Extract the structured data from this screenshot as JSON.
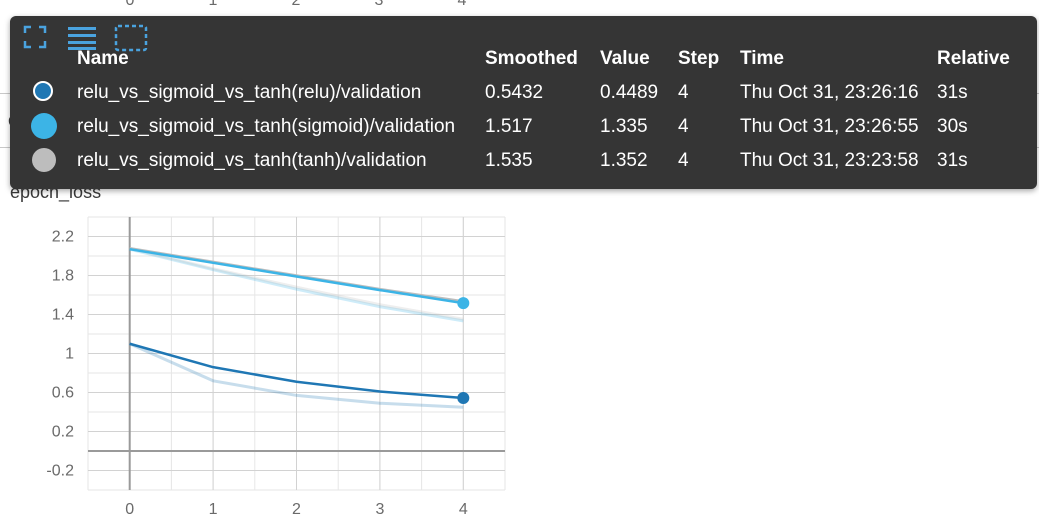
{
  "top_axis_ticks": [
    "0",
    "1",
    "2",
    "3",
    "4"
  ],
  "background_title": "epoch_loss",
  "chart_data": {
    "type": "line",
    "title": "epoch_loss",
    "xlabel": "",
    "ylabel": "",
    "xlim": [
      -0.5,
      4.5
    ],
    "ylim": [
      -0.4,
      2.4
    ],
    "x_ticks": [
      0,
      1,
      2,
      3,
      4
    ],
    "x_tick_labels": [
      "0",
      "1",
      "2",
      "3",
      "4"
    ],
    "y_ticks": [
      -0.2,
      0.2,
      0.6,
      1.0,
      1.4,
      1.8,
      2.2
    ],
    "y_tick_labels": [
      "-0.2",
      "0.2",
      "0.6",
      "1",
      "1.4",
      "1.8",
      "2.2"
    ],
    "grid": true,
    "series": [
      {
        "name": "relu_vs_sigmoid_vs_tanh(relu)/validation",
        "color": "#1f77b4",
        "x": [
          0,
          1,
          2,
          3,
          4
        ],
        "smoothed": [
          1.1,
          0.86,
          0.71,
          0.61,
          0.5432
        ],
        "raw": [
          1.1,
          0.72,
          0.57,
          0.49,
          0.4489
        ]
      },
      {
        "name": "relu_vs_sigmoid_vs_tanh(sigmoid)/validation",
        "color": "#3cb4e6",
        "x": [
          0,
          1,
          2,
          3,
          4
        ],
        "smoothed": [
          2.07,
          1.93,
          1.79,
          1.65,
          1.517
        ],
        "raw": [
          2.07,
          1.86,
          1.66,
          1.48,
          1.335
        ]
      },
      {
        "name": "relu_vs_sigmoid_vs_tanh(tanh)/validation",
        "color": "#bdbdbd",
        "x": [
          0,
          1,
          2,
          3,
          4
        ],
        "smoothed": [
          2.08,
          1.94,
          1.8,
          1.66,
          1.535
        ],
        "raw": [
          2.08,
          1.87,
          1.68,
          1.5,
          1.352
        ]
      }
    ]
  },
  "tooltip": {
    "headers": {
      "name": "Name",
      "smoothed": "Smoothed",
      "value": "Value",
      "step": "Step",
      "time": "Time",
      "relative": "Relative"
    },
    "rows": [
      {
        "swatch_color": "#1f77b4",
        "name": "relu_vs_sigmoid_vs_tanh(relu)/validation",
        "smoothed": "0.5432",
        "value": "0.4489",
        "step": "4",
        "time": "Thu Oct 31, 23:26:16",
        "relative": "31s"
      },
      {
        "swatch_color": "#3cb4e6",
        "name": "relu_vs_sigmoid_vs_tanh(sigmoid)/validation",
        "smoothed": "1.517",
        "value": "1.335",
        "step": "4",
        "time": "Thu Oct 31, 23:26:55",
        "relative": "30s"
      },
      {
        "swatch_color": "#bdbdbd",
        "name": "relu_vs_sigmoid_vs_tanh(tanh)/validation",
        "smoothed": "1.535",
        "value": "1.352",
        "step": "4",
        "time": "Thu Oct 31, 23:23:58",
        "relative": "31s"
      }
    ]
  },
  "toolbar_icons": [
    "fullscreen-icon",
    "list-icon",
    "fit-domain-icon"
  ]
}
